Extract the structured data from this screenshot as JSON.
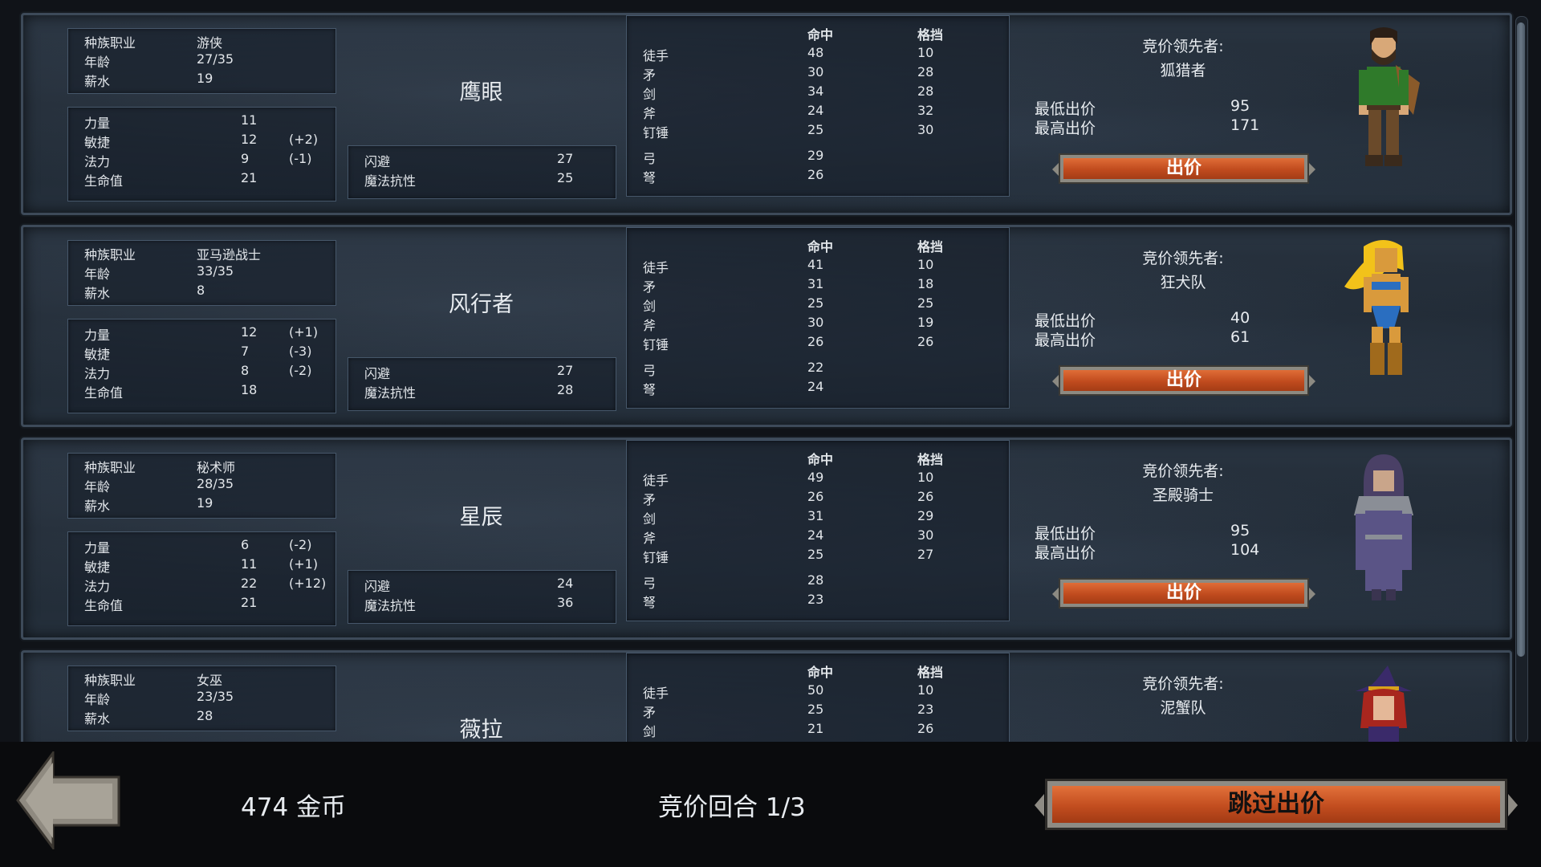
{
  "labels": {
    "race_class": "种族职业",
    "age": "年龄",
    "salary": "薪水",
    "strength": "力量",
    "agility": "敏捷",
    "magic": "法力",
    "hp": "生命值",
    "dodge": "闪避",
    "magic_resist": "魔法抗性",
    "hit": "命中",
    "block": "格挡",
    "unarmed": "徒手",
    "spear": "矛",
    "sword": "剑",
    "axe": "斧",
    "mace": "钉锤",
    "bow": "弓",
    "crossbow": "弩",
    "leader_title": "竞价领先者:",
    "min_bid": "最低出价",
    "max_bid": "最高出价",
    "bid_button": "出价"
  },
  "heroes": [
    {
      "name": "鹰眼",
      "race_class": "游侠",
      "age": "27/35",
      "salary": "19",
      "strength": "11",
      "strength_mod": "",
      "agility": "12",
      "agility_mod": "(+2)",
      "magic": "9",
      "magic_mod": "(-1)",
      "hp": "21",
      "dodge": "27",
      "magic_resist": "25",
      "unarmed_hit": "48",
      "unarmed_block": "10",
      "spear_hit": "30",
      "spear_block": "28",
      "sword_hit": "34",
      "sword_block": "28",
      "axe_hit": "24",
      "axe_block": "32",
      "mace_hit": "25",
      "mace_block": "30",
      "bow_hit": "29",
      "crossbow_hit": "26",
      "leader": "狐猎者",
      "min_bid": "95",
      "max_bid": "171",
      "portrait": "ranger-portrait"
    },
    {
      "name": "风行者",
      "race_class": "亚马逊战士",
      "age": "33/35",
      "salary": "8",
      "strength": "12",
      "strength_mod": "(+1)",
      "agility": "7",
      "agility_mod": "(-3)",
      "magic": "8",
      "magic_mod": "(-2)",
      "hp": "18",
      "dodge": "27",
      "magic_resist": "28",
      "unarmed_hit": "41",
      "unarmed_block": "10",
      "spear_hit": "31",
      "spear_block": "18",
      "sword_hit": "25",
      "sword_block": "25",
      "axe_hit": "30",
      "axe_block": "19",
      "mace_hit": "26",
      "mace_block": "26",
      "bow_hit": "22",
      "crossbow_hit": "24",
      "leader": "狂犬队",
      "min_bid": "40",
      "max_bid": "61",
      "portrait": "amazon-portrait"
    },
    {
      "name": "星辰",
      "race_class": "秘术师",
      "age": "28/35",
      "salary": "19",
      "strength": "6",
      "strength_mod": "(-2)",
      "agility": "11",
      "agility_mod": "(+1)",
      "magic": "22",
      "magic_mod": "(+12)",
      "hp": "21",
      "dodge": "24",
      "magic_resist": "36",
      "unarmed_hit": "49",
      "unarmed_block": "10",
      "spear_hit": "26",
      "spear_block": "26",
      "sword_hit": "31",
      "sword_block": "29",
      "axe_hit": "24",
      "axe_block": "30",
      "mace_hit": "25",
      "mace_block": "27",
      "bow_hit": "28",
      "crossbow_hit": "23",
      "leader": "圣殿骑士",
      "min_bid": "95",
      "max_bid": "104",
      "portrait": "mystic-portrait"
    },
    {
      "name": "薇拉",
      "race_class": "女巫",
      "age": "23/35",
      "salary": "28",
      "unarmed_hit": "50",
      "unarmed_block": "10",
      "spear_hit": "25",
      "spear_block": "23",
      "sword_hit": "21",
      "sword_block": "26",
      "leader": "泥蟹队",
      "portrait": "witch-portrait"
    }
  ],
  "footer": {
    "gold": "474 金币",
    "round": "竞价回合 1/3",
    "skip_label": "跳过出价"
  },
  "colors": {
    "button_orange": "#c9541f",
    "card_bg": "#222c37"
  }
}
